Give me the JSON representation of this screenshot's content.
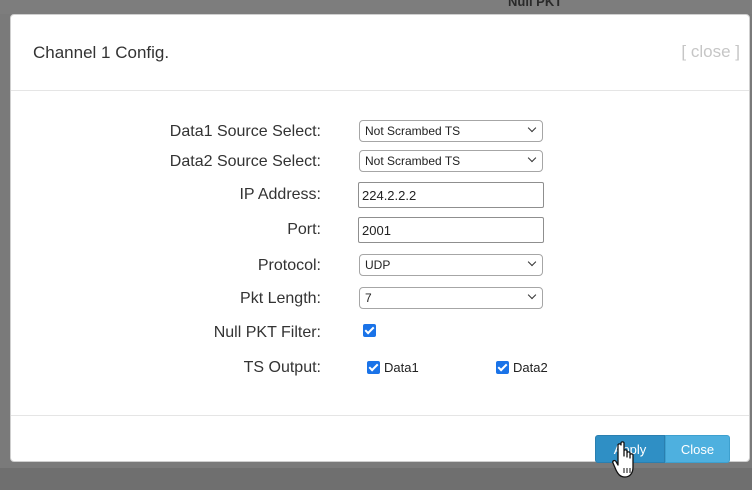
{
  "background": {
    "partial_header_text": "Null PKT"
  },
  "dialog": {
    "title": "Channel 1 Config.",
    "close_link": "[ close ]",
    "fields": {
      "data1_source": {
        "label": "Data1 Source Select:",
        "value": "Not Scrambed TS"
      },
      "data2_source": {
        "label": "Data2 Source Select:",
        "value": "Not Scrambed TS"
      },
      "ip_address": {
        "label": "IP Address:",
        "value": "224.2.2.2"
      },
      "port": {
        "label": "Port:",
        "value": "2001"
      },
      "protocol": {
        "label": "Protocol:",
        "value": "UDP"
      },
      "pkt_length": {
        "label": "Pkt Length:",
        "value": "7"
      },
      "null_pkt_filter": {
        "label": "Null PKT Filter:",
        "checked": true
      },
      "ts_output": {
        "label": "TS Output:",
        "data1": {
          "label": "Data1",
          "checked": true
        },
        "data2": {
          "label": "Data2",
          "checked": true
        }
      }
    },
    "buttons": {
      "apply": "Apply",
      "close": "Close"
    }
  },
  "colors": {
    "overlay": "#7a7a7a",
    "checkbox": "#1a73e8",
    "apply_button": "#2f8fc5",
    "close_button": "#4eb0df"
  },
  "cursor": "hand-pointer-icon"
}
